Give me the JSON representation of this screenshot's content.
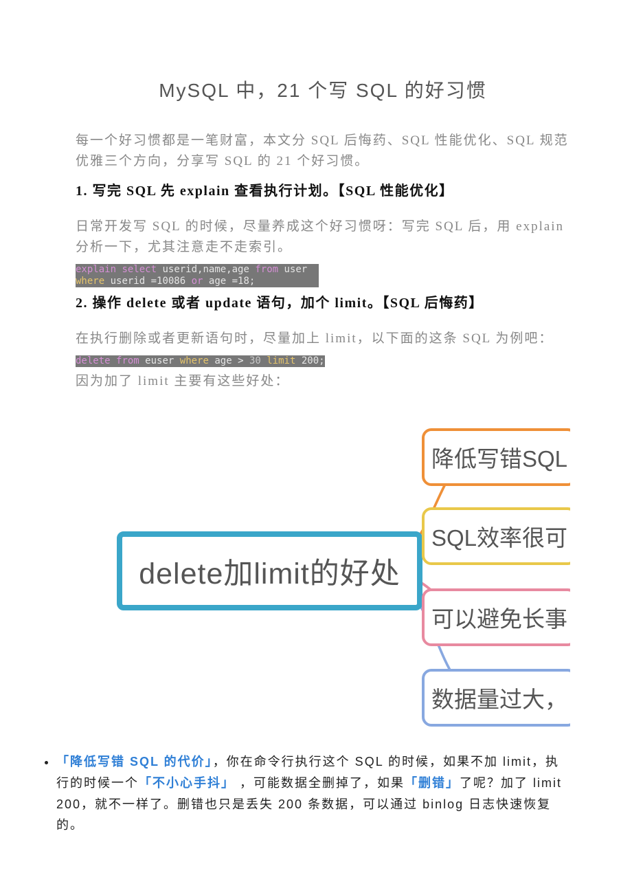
{
  "title": "MySQL 中，21 个写 SQL 的好习惯",
  "intro": "每一个好习惯都是一笔财富，本文分 SQL 后悔药、SQL 性能优化、SQL 规范优雅三个方向，分享写 SQL 的 21 个好习惯。",
  "section1": {
    "heading": "1. 写完 SQL 先 explain 查看执行计划。【SQL 性能优化】",
    "body": "日常开发写 SQL 的时候，尽量养成这个好习惯呀：写完 SQL 后，用 explain 分析一下，尤其注意走不走索引。",
    "code_tokens": [
      {
        "t": "explain",
        "c": "kw"
      },
      {
        "t": " "
      },
      {
        "t": "select",
        "c": "kw"
      },
      {
        "t": " "
      },
      {
        "t": "userid,name,age",
        "c": "ident"
      },
      {
        "t": " "
      },
      {
        "t": "from",
        "c": "kw"
      },
      {
        "t": " "
      },
      {
        "t": "user  \n",
        "c": "ident"
      },
      {
        "t": "where",
        "c": "lim"
      },
      {
        "t": " "
      },
      {
        "t": "userid =10086",
        "c": "ident"
      },
      {
        "t": " "
      },
      {
        "t": "or",
        "c": "kw"
      },
      {
        "t": " "
      },
      {
        "t": "age =18;",
        "c": "ident"
      }
    ]
  },
  "section2": {
    "heading": "2. 操作 delete 或者 update 语句，加个 limit。【SQL 后悔药】",
    "body": "在执行删除或者更新语句时，尽量加上 limit，以下面的这条 SQL 为例吧：",
    "code_tokens": [
      {
        "t": "delete",
        "c": "kw"
      },
      {
        "t": " "
      },
      {
        "t": "from",
        "c": "kw"
      },
      {
        "t": " "
      },
      {
        "t": "euser",
        "c": "ident"
      },
      {
        "t": " "
      },
      {
        "t": "where",
        "c": "lim"
      },
      {
        "t": " "
      },
      {
        "t": "age",
        "c": "ident"
      },
      {
        "t": " > "
      },
      {
        "t": "30",
        "c": "num"
      },
      {
        "t": " "
      },
      {
        "t": "limit",
        "c": "lim"
      },
      {
        "t": " "
      },
      {
        "t": "200;",
        "c": "ident"
      }
    ],
    "after_code": "因为加了 limit 主要有这些好处："
  },
  "diagram": {
    "center": "delete加limit的好处",
    "leaves": [
      "降低写错SQL",
      "SQL效率很可",
      "可以避免长事",
      "数据量过大，"
    ]
  },
  "bullet1": {
    "hl1": "「降低写错 SQL 的代价」",
    "t1": "，你在命令行执行这个 SQL 的时候，如果不加 limit，执行的时候一个",
    "hl2": "「不小心手抖」",
    "t2": " ，可能数据全删掉了，如果",
    "hl3": "「删错」",
    "t3": "了呢？加了 limit 200，就不一样了。删错也只是丢失 200 条数据，可以通过 binlog 日志快速恢复的。"
  }
}
